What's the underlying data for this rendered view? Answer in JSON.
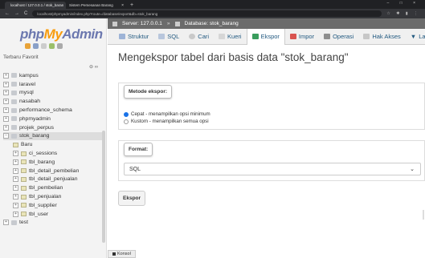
{
  "browser": {
    "tabs": [
      {
        "label": "localhost / 127.0.0.1 / stok_baran",
        "close": "×"
      },
      {
        "label": "Sistem Pemesanan Barang",
        "close": "×"
      }
    ],
    "new_tab": "+",
    "window_controls": "–  □  ×",
    "url": "localhost/phpmyadmin/index.php?route=/database/export&db=stok_barang",
    "nav_back": "←",
    "nav_forward": "→",
    "nav_reload": "C"
  },
  "sidebar": {
    "logo": {
      "php": "php",
      "my": "My",
      "admin": "Admin"
    },
    "recent_label": "Terbaru  Favorit",
    "collapse": "⊖ ∞",
    "databases": [
      {
        "name": "kampus",
        "expanded": false
      },
      {
        "name": "laravel",
        "expanded": false
      },
      {
        "name": "mysql",
        "expanded": false
      },
      {
        "name": "nasabah",
        "expanded": false
      },
      {
        "name": "performance_schema",
        "expanded": false
      },
      {
        "name": "phpmyadmin",
        "expanded": false
      },
      {
        "name": "projek_perpus",
        "expanded": false
      },
      {
        "name": "stok_barang",
        "expanded": true
      }
    ],
    "stok_items": [
      "Baru",
      "ci_sessions",
      "tbl_barang",
      "tbl_detail_pembelian",
      "tbl_detail_penjualan",
      "tbl_pembelian",
      "tbl_penjualan",
      "tbl_supplier",
      "tbl_user"
    ],
    "last_db": "test",
    "console": "Konsol"
  },
  "serverbar": {
    "server": "Server: 127.0.0.1",
    "sep": "»",
    "database": "Database: stok_barang"
  },
  "navtabs": [
    "Struktur",
    "SQL",
    "Cari",
    "Kueri",
    "Ekspor",
    "Impor",
    "Operasi",
    "Hak Akses",
    "La"
  ],
  "active_tab": "Ekspor",
  "main": {
    "title": "Mengekspor tabel dari basis data \"stok_barang\"",
    "method_legend": "Metode ekspor:",
    "method_quick": "Cepat - menampilkan opsi minimum",
    "method_custom": "Kustom - menampilkan semua opsi",
    "format_legend": "Format:",
    "format_value": "SQL",
    "export_button": "Ekspor"
  },
  "colors": {
    "logo_blue": "#6c78af",
    "logo_orange": "#f89c0e",
    "serverbar_bg": "#6b6b6b",
    "link": "#235a81"
  }
}
